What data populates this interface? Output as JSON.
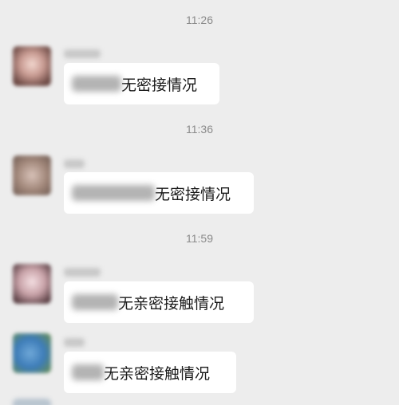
{
  "messages": [
    {
      "time": "11:26",
      "text": "无密接情况"
    },
    {
      "time": "11:36",
      "text": "无密接情况"
    },
    {
      "time": "11:59",
      "text": "无亲密接触情况"
    },
    {
      "time": "",
      "text": "无亲密接触情况"
    }
  ],
  "colors": {
    "background": "#ededed",
    "bubble": "#ffffff",
    "timestamp": "#8a8a8a"
  }
}
